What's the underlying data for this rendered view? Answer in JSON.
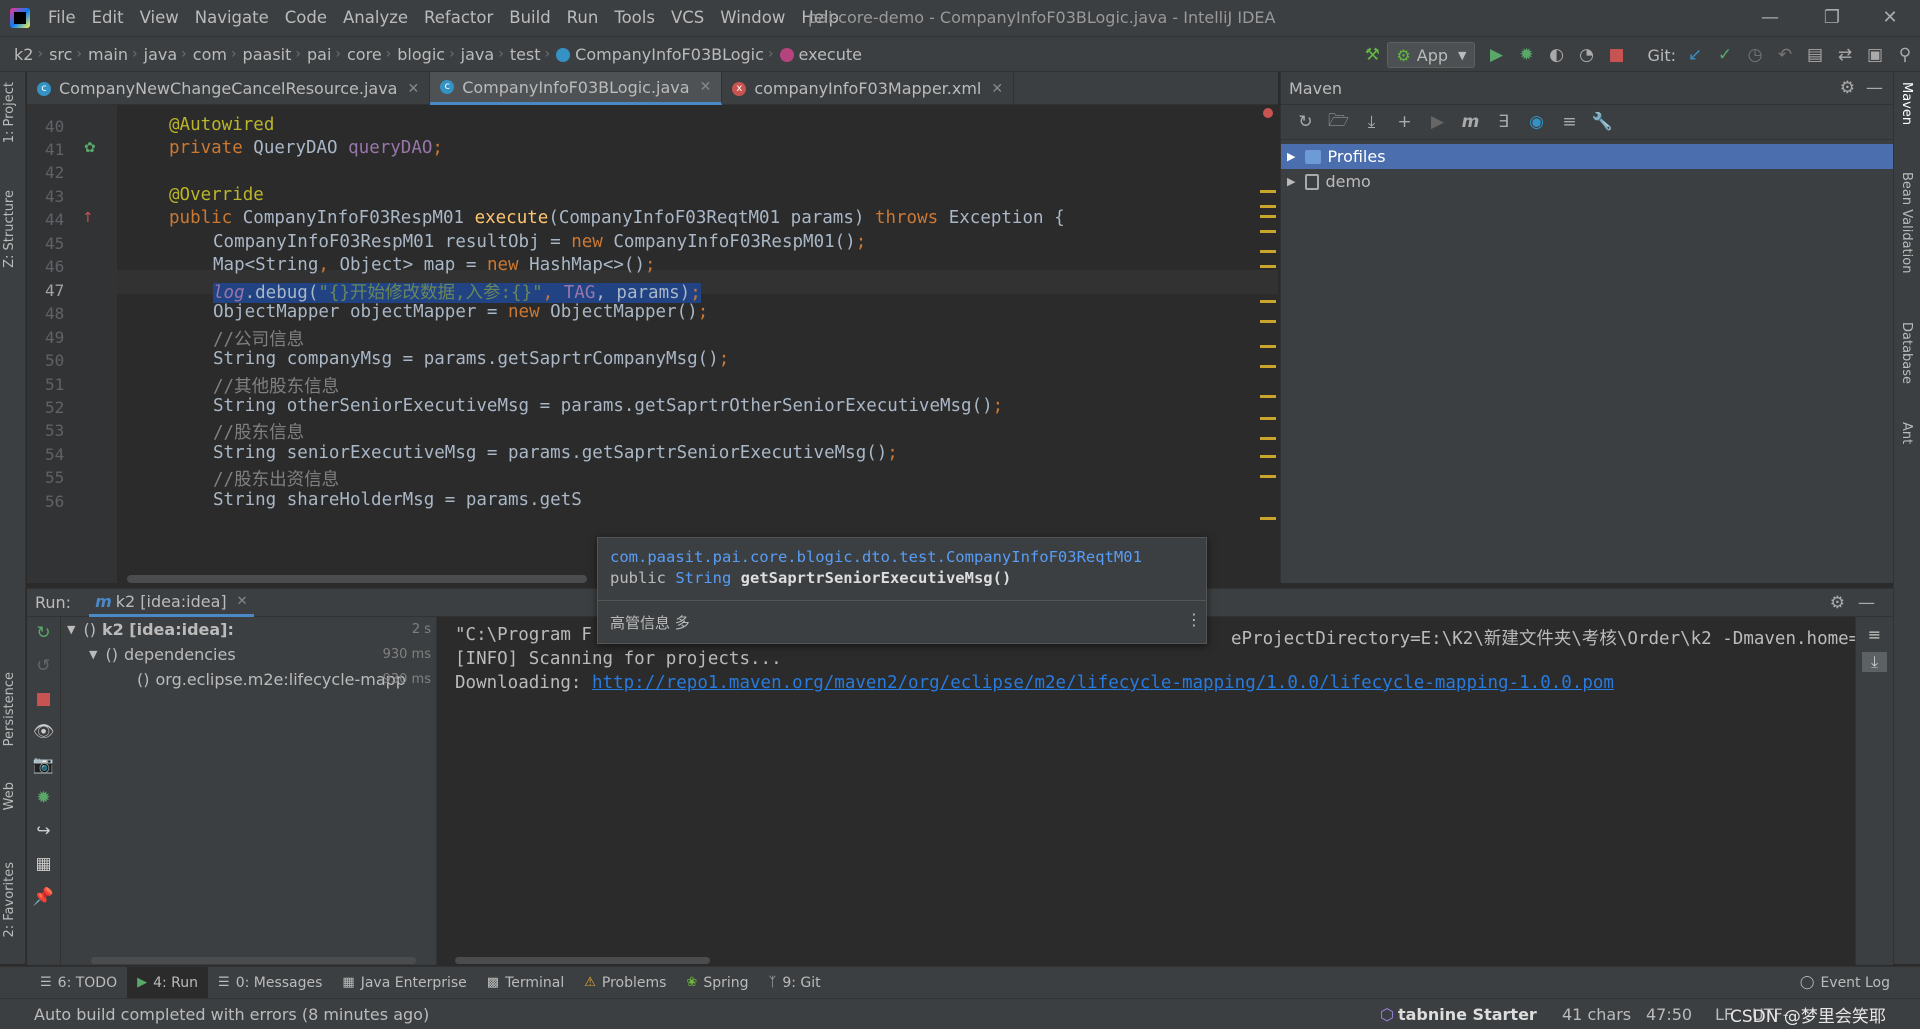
{
  "menubar": {
    "items": [
      "File",
      "Edit",
      "View",
      "Navigate",
      "Code",
      "Analyze",
      "Refactor",
      "Build",
      "Run",
      "Tools",
      "VCS",
      "Window",
      "Help"
    ],
    "window_title": "pai-core-demo - CompanyInfoF03BLogic.java - IntelliJ IDEA"
  },
  "navbar": {
    "crumbs": [
      "k2",
      "src",
      "main",
      "java",
      "com",
      "paasit",
      "pai",
      "core",
      "blogic",
      "java",
      "test",
      "CompanyInfoF03BLogic",
      "execute"
    ],
    "run_config": "App",
    "git_label": "Git:"
  },
  "tabs": [
    {
      "label": "CompanyNewChangeCancelResource.java",
      "active": false
    },
    {
      "label": "CompanyInfoF03BLogic.java",
      "active": true
    },
    {
      "label": "companyInfoF03Mapper.xml",
      "active": false
    }
  ],
  "editor": {
    "lines": [
      {
        "n": "40",
        "cur": false
      },
      {
        "n": "41",
        "cur": false
      },
      {
        "n": "42",
        "cur": false
      },
      {
        "n": "43",
        "cur": false
      },
      {
        "n": "44",
        "cur": false
      },
      {
        "n": "45",
        "cur": false
      },
      {
        "n": "46",
        "cur": false
      },
      {
        "n": "47",
        "cur": true
      },
      {
        "n": "48",
        "cur": false
      },
      {
        "n": "49",
        "cur": false
      },
      {
        "n": "50",
        "cur": false
      },
      {
        "n": "51",
        "cur": false
      },
      {
        "n": "52",
        "cur": false
      },
      {
        "n": "53",
        "cur": false
      },
      {
        "n": "54",
        "cur": false
      },
      {
        "n": "55",
        "cur": false
      },
      {
        "n": "56",
        "cur": false
      }
    ],
    "code": {
      "l40": "@Autowired",
      "l41a": "private ",
      "l41b": "QueryDAO ",
      "l41c": "queryDAO",
      "l41d": ";",
      "l43": "@Override",
      "l44a": "public ",
      "l44b": "CompanyInfoF03RespM01 ",
      "l44c": "execute",
      "l44d": "(CompanyInfoF03ReqtM01 params) ",
      "l44e": "throws ",
      "l44f": "Exception {",
      "l45a": "CompanyInfoF03RespM01 resultObj = ",
      "l45b": "new ",
      "l45c": "CompanyInfoF03RespM01()",
      "l45d": ";",
      "l46a": "Map<String",
      "l46b": ", ",
      "l46c": "Object> map = ",
      "l46d": "new ",
      "l46e": "HashMap<>()",
      "l46f": ";",
      "l47a": "log",
      "l47b": ".debug(",
      "l47c": "\"{}开始修改数据,入参:{}\"",
      "l47d": ", ",
      "l47e": "TAG",
      "l47f": ", params)",
      "l47g": ";",
      "l48a": "ObjectMapper objectMapper = ",
      "l48b": "new ",
      "l48c": "ObjectMapper()",
      "l48d": ";",
      "l49": "//公司信息",
      "l50a": "String companyMsg = params.getSaprtrCompanyMsg()",
      "l50b": ";",
      "l51": "//其他股东信息",
      "l52a": "String otherSeniorExecutiveMsg = params.getSaprtrOtherSeniorExecutiveMsg()",
      "l52b": ";",
      "l53": "//股东信息",
      "l54a": "String seniorExecutiveMsg = params.getSaprtrSeniorExecutiveMsg()",
      "l54b": ";",
      "l55": "//股东出资信息",
      "l56": "String shareHolderMsg = params.getS"
    }
  },
  "tooltip": {
    "class_name": "com.paasit.pai.core.blogic.dto.test.CompanyInfoF03ReqtM01",
    "sig_kw": "public ",
    "sig_type": "String ",
    "sig_method": "getSaprtrSeniorExecutiveMsg()",
    "doc": "高管信息 多"
  },
  "maven": {
    "title": "Maven",
    "items": [
      {
        "label": "Profiles",
        "selected": true
      },
      {
        "label": "demo",
        "selected": false
      }
    ]
  },
  "run": {
    "label": "Run:",
    "tab": "k2 [idea:idea]",
    "tree": [
      {
        "label": "k2 [idea:idea]:",
        "time": "2 s"
      },
      {
        "label": "dependencies",
        "time": "930 ms"
      },
      {
        "label": "org.eclipse.m2e:lifecycle-mapp",
        "time": "930 ms"
      }
    ],
    "console": {
      "line1a": "\"C:\\Program F",
      "line1b": "eProjectDirectory=E:\\K2\\新建文件夹\\考核\\Order\\k2 -Dmaven.home=",
      "line2": "[INFO] Scanning for projects...",
      "line3_prefix": "Downloading: ",
      "line3_link": "http://repo1.maven.org/maven2/org/eclipse/m2e/lifecycle-mapping/1.0.0/lifecycle-mapping-1.0.0.pom"
    }
  },
  "left_tools": [
    "1: Project",
    "Z: Structure",
    "Persistence",
    "Web",
    "2: Favorites"
  ],
  "right_tools": [
    "Maven",
    "Bean Validation",
    "Database",
    "Ant"
  ],
  "bottom_tabs": [
    {
      "label": "6: TODO",
      "active": false
    },
    {
      "label": "4: Run",
      "active": true
    },
    {
      "label": "0: Messages",
      "active": false
    },
    {
      "label": "Java Enterprise",
      "active": false
    },
    {
      "label": "Terminal",
      "active": false
    },
    {
      "label": "Problems",
      "active": false
    },
    {
      "label": "Spring",
      "active": false
    },
    {
      "label": "9: Git",
      "active": false
    }
  ],
  "event_log": "Event Log",
  "status": {
    "message": "Auto build completed with errors (8 minutes ago)",
    "tabnine": "tabnine Starter",
    "chars": "41 chars",
    "position": "47:50",
    "line_sep": "LF",
    "encoding": "UTF-",
    "watermark": "CSDN @梦里会笑耶"
  },
  "colors": {
    "accent": "#4a88c7",
    "selection": "#214283",
    "maven_selected": "#4b6eaf",
    "link": "#287bde"
  }
}
